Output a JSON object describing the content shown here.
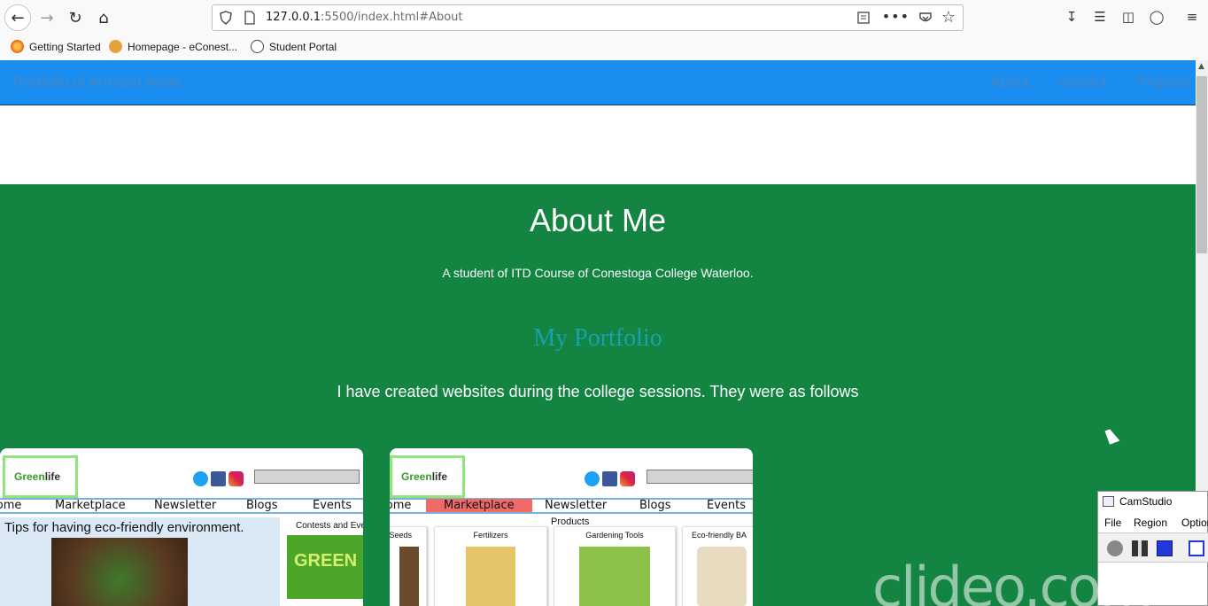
{
  "browser": {
    "url_host": "127.0.0.1",
    "url_rest": ":5500/index.html#About",
    "bookmarks": [
      {
        "label": "Getting Started",
        "icon": "firefox-icon"
      },
      {
        "label": "Homepage - eConest...",
        "icon": "econestoga-icon"
      },
      {
        "label": "Student Portal",
        "icon": "globe-icon"
      }
    ]
  },
  "site": {
    "brand": "Portfolio of Armaan Rana",
    "nav": [
      "About",
      "contact",
      "Projects"
    ]
  },
  "about": {
    "title": "About Me",
    "subtitle": "A student of ITD Course of Conestoga College Waterloo.",
    "portfolio_title": "My Portfolio",
    "description": "I have created websites during the college sessions. They were as follows"
  },
  "cards": [
    {
      "logo": "Greenlife",
      "menu": [
        "Home",
        "Marketplace",
        "Newsletter",
        "Blogs",
        "Events"
      ],
      "tips": "Tips for having eco-friendly environment.",
      "contests": "Contests and Eve"
    },
    {
      "logo": "Greenlife",
      "menu": [
        "Home",
        "Marketplace",
        "Newsletter",
        "Blogs",
        "Events"
      ],
      "products_title": "Products",
      "products": [
        "Seeds",
        "Fertilizers",
        "Gardening Tools",
        "Eco-friendly BA"
      ]
    }
  ],
  "camstudio": {
    "title": "CamStudio",
    "menu": [
      "File",
      "Region",
      "Option"
    ]
  },
  "watermark": "clideo.com",
  "colors": {
    "navbar": "#1a8ef0",
    "about_bg": "#138441",
    "portfolio_heading": "#1ba0b0"
  }
}
